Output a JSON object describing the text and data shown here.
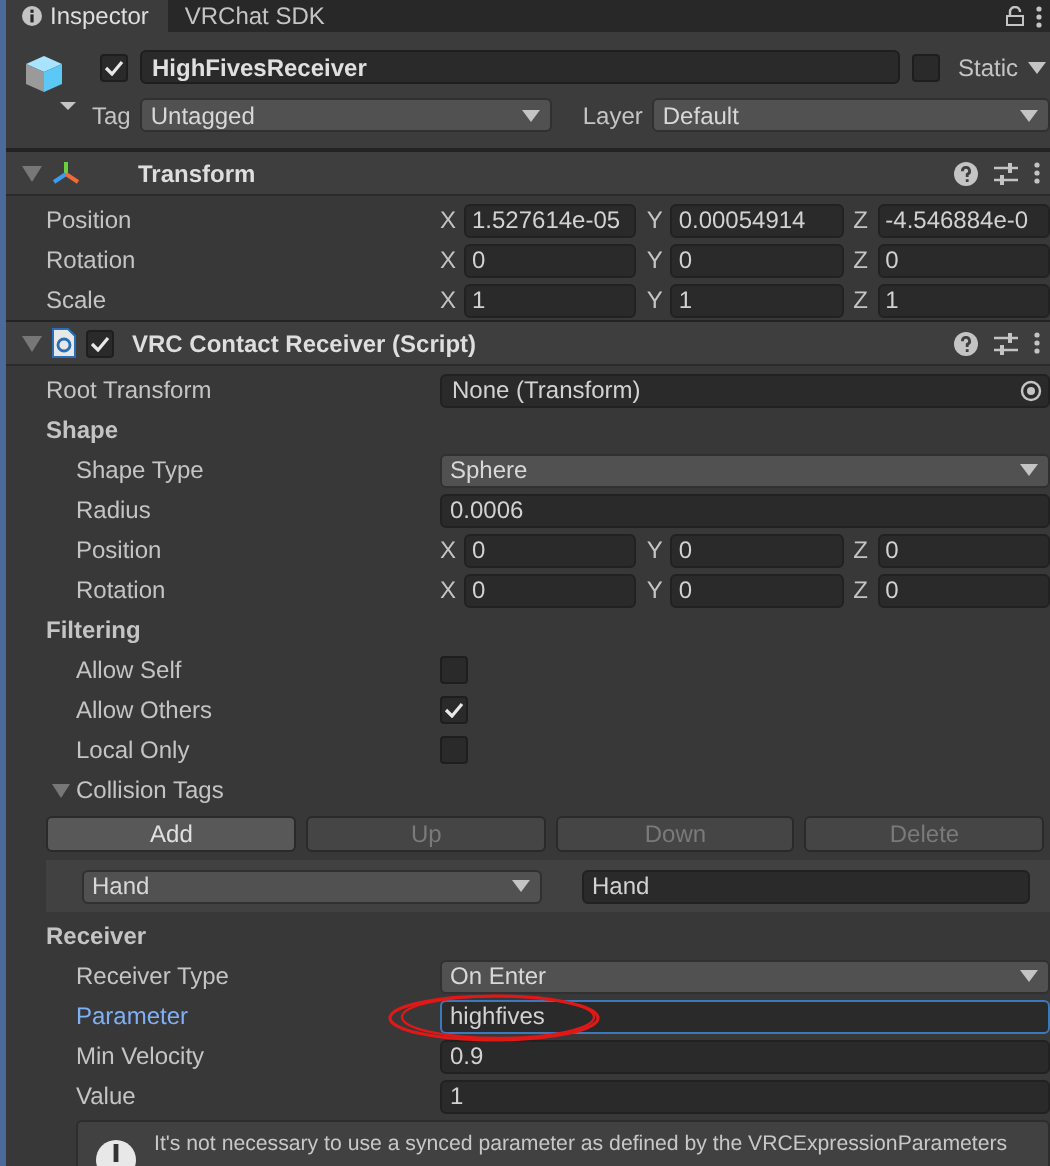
{
  "tabs": [
    {
      "label": "Inspector",
      "selected": true
    },
    {
      "label": "VRChat SDK",
      "selected": false
    }
  ],
  "object": {
    "active": true,
    "name": "HighFivesReceiver",
    "static": false,
    "static_label": "Static",
    "tag_label": "Tag",
    "tag": "Untagged",
    "layer_label": "Layer",
    "layer": "Default"
  },
  "components": [
    {
      "kind": "transform",
      "title": "Transform",
      "expanded": true,
      "rows": [
        {
          "kind": "vector",
          "label": "Position",
          "values": [
            {
              "axis": "X",
              "value": "1.527614e-05"
            },
            {
              "axis": "Y",
              "value": "0.00054914"
            },
            {
              "axis": "Z",
              "value": "-4.546884e-0"
            }
          ]
        },
        {
          "kind": "vector",
          "label": "Rotation",
          "values": [
            {
              "axis": "X",
              "value": "0"
            },
            {
              "axis": "Y",
              "value": "0"
            },
            {
              "axis": "Z",
              "value": "0"
            }
          ]
        },
        {
          "kind": "vector",
          "label": "Scale",
          "values": [
            {
              "axis": "X",
              "value": "1"
            },
            {
              "axis": "Y",
              "value": "1"
            },
            {
              "axis": "Z",
              "value": "1"
            }
          ]
        }
      ]
    },
    {
      "kind": "script",
      "title": "VRC Contact Receiver (Script)",
      "expanded": true,
      "enabled": true,
      "rows": [
        {
          "kind": "object",
          "label": "Root Transform",
          "value": "None (Transform)"
        },
        {
          "kind": "section",
          "label": "Shape",
          "children": [
            {
              "kind": "dropdown",
              "label": "Shape Type",
              "value": "Sphere"
            },
            {
              "kind": "field",
              "label": "Radius",
              "value": "0.0006",
              "focused": false
            },
            {
              "kind": "vector",
              "label": "Position",
              "values": [
                {
                  "axis": "X",
                  "value": "0"
                },
                {
                  "axis": "Y",
                  "value": "0"
                },
                {
                  "axis": "Z",
                  "value": "0"
                }
              ]
            },
            {
              "kind": "vector",
              "label": "Rotation",
              "values": [
                {
                  "axis": "X",
                  "value": "0"
                },
                {
                  "axis": "Y",
                  "value": "0"
                },
                {
                  "axis": "Z",
                  "value": "0"
                }
              ]
            }
          ]
        },
        {
          "kind": "section",
          "label": "Filtering",
          "children": [
            {
              "kind": "checkbox",
              "label": "Allow Self",
              "checked": false
            },
            {
              "kind": "checkbox",
              "label": "Allow Others",
              "checked": true
            },
            {
              "kind": "checkbox",
              "label": "Local Only",
              "checked": false
            },
            {
              "kind": "foldout",
              "label": "Collision Tags",
              "expanded": true,
              "buttons": [
                {
                  "label": "Add",
                  "disabled": false
                },
                {
                  "label": "Up",
                  "disabled": true
                },
                {
                  "label": "Down",
                  "disabled": true
                },
                {
                  "label": "Delete",
                  "disabled": true
                }
              ],
              "items": [
                {
                  "tag": "Hand",
                  "value": "Hand"
                }
              ]
            }
          ]
        },
        {
          "kind": "section",
          "label": "Receiver",
          "children": [
            {
              "kind": "dropdown",
              "label": "Receiver Type",
              "value": "On Enter"
            },
            {
              "kind": "field",
              "label": "Parameter",
              "value": "highfives",
              "focused": true
            },
            {
              "kind": "field",
              "label": "Min Velocity",
              "value": "0.9",
              "focused": false
            },
            {
              "kind": "field",
              "label": "Value",
              "value": "1",
              "focused": false
            },
            {
              "kind": "help",
              "text": "It's not necessary to use a synced parameter as defined by the VRCExpressionParameters"
            }
          ]
        }
      ]
    }
  ]
}
